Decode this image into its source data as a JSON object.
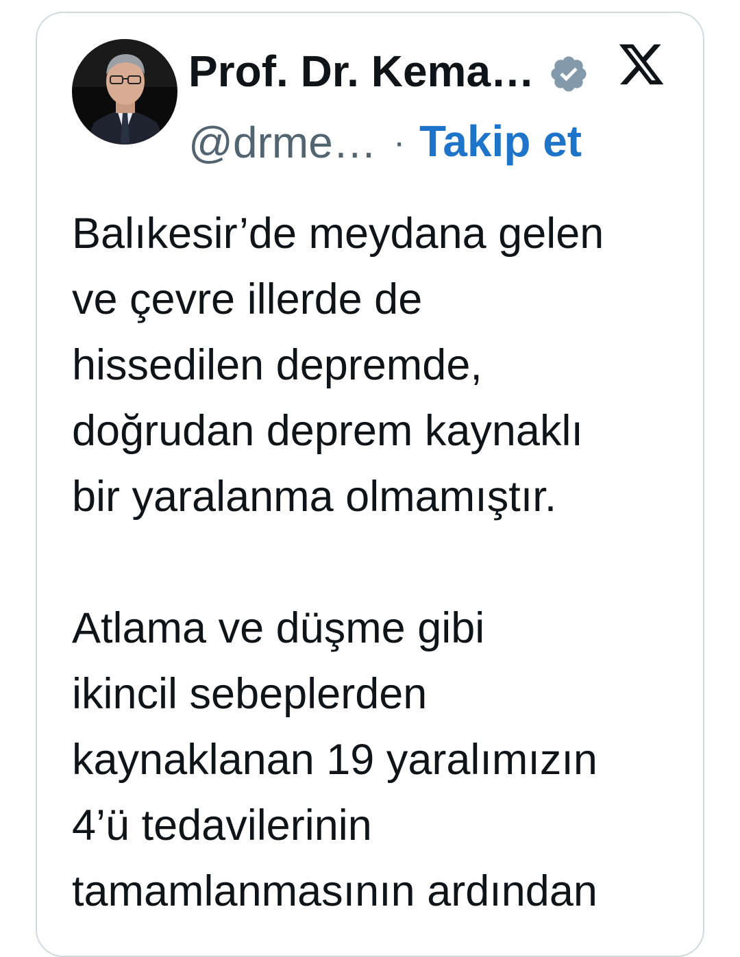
{
  "tweet": {
    "author": {
      "display_name": "Prof. Dr. Kema…",
      "handle": "@drme…",
      "verified": true,
      "avatar_icon": "profile-photo"
    },
    "separator": "·",
    "follow_label": "Takip et",
    "platform_icon": "x-logo",
    "paragraphs": [
      "Balıkesir’de meydana gelen\nve çevre illerde de\nhissedilen depremde,\ndoğrudan deprem kaynaklı\nbir yaralanma olmamıştır.",
      "Atlama ve düşme gibi\nikincil sebeplerden\nkaynaklanan 19 yaralımızın\n4’ü tedavilerinin\ntamamlanmasının ardından"
    ]
  },
  "colors": {
    "text": "#0f1419",
    "secondary": "#536471",
    "link": "#1d74c9",
    "border": "#cfd9de",
    "verified_badge": "#829aab"
  }
}
